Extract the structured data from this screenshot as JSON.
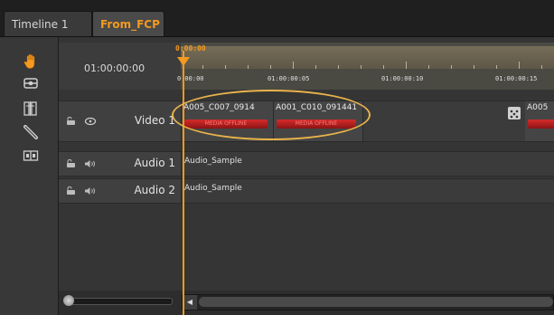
{
  "tabs": [
    {
      "label": "Timeline 1",
      "active": false
    },
    {
      "label": "From_FCP",
      "active": true
    }
  ],
  "toolbar": {
    "tools": [
      {
        "name": "hand-tool",
        "icon": "hand-icon"
      },
      {
        "name": "select-tool",
        "icon": "selection-icon"
      },
      {
        "name": "trim-tool",
        "icon": "trim-icon"
      },
      {
        "name": "razor-tool",
        "icon": "razor-icon"
      },
      {
        "name": "slip-tool",
        "icon": "slip-icon"
      }
    ]
  },
  "timeline": {
    "timecode": "01:00:00:00",
    "playhead_tc": "0:00:00",
    "ruler_labels": [
      "0:00:00",
      "01:00:00:05",
      "01:00:00:10",
      "01:00:00:15"
    ],
    "accent_color": "#f39a1f",
    "annotation_color": "#e9b34a"
  },
  "tracks": [
    {
      "name": "Video 1",
      "type": "video",
      "clips": [
        {
          "title": "A005_C007_0914",
          "status": "MEDIA OFFLINE"
        },
        {
          "title": "A001_C010_091441",
          "status": "MEDIA OFFLINE"
        },
        {
          "title": "A005",
          "status": ""
        }
      ]
    },
    {
      "name": "Audio 1",
      "type": "audio",
      "clip": "Audio_Sample"
    },
    {
      "name": "Audio 2",
      "type": "audio",
      "clip": "Audio_Sample"
    }
  ]
}
